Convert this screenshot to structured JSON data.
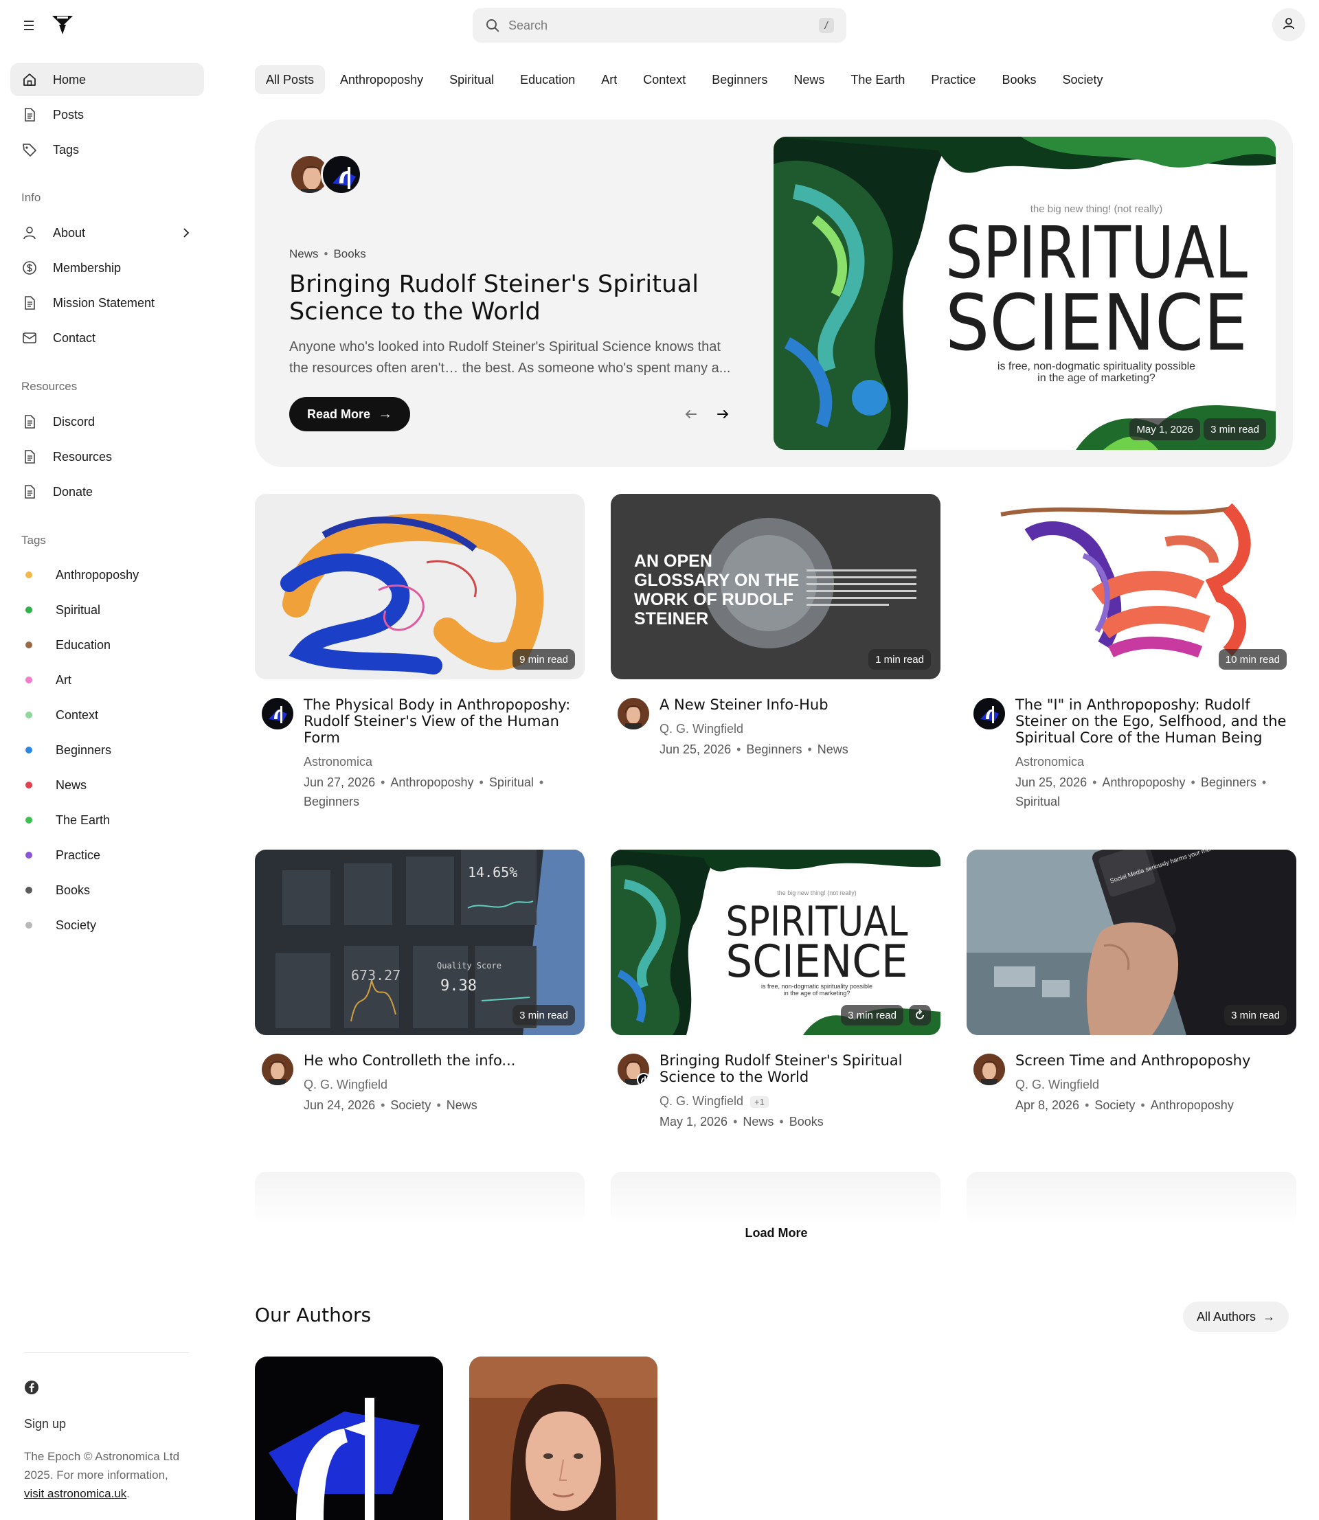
{
  "search": {
    "placeholder": "Search",
    "shortcut": "/"
  },
  "sidebar": {
    "main": [
      {
        "label": "Home",
        "icon": "home-icon"
      },
      {
        "label": "Posts",
        "icon": "document-icon"
      },
      {
        "label": "Tags",
        "icon": "tag-icon"
      }
    ],
    "info_label": "Info",
    "info": [
      {
        "label": "About",
        "icon": "person-icon"
      },
      {
        "label": "Membership",
        "icon": "dollar-icon"
      },
      {
        "label": "Mission Statement",
        "icon": "document-icon"
      },
      {
        "label": "Contact",
        "icon": "mail-icon"
      }
    ],
    "resources_label": "Resources",
    "resources": [
      {
        "label": "Discord",
        "icon": "document-icon"
      },
      {
        "label": "Resources",
        "icon": "document-icon"
      },
      {
        "label": "Donate",
        "icon": "document-icon"
      }
    ],
    "tags_label": "Tags",
    "tags": [
      {
        "label": "Anthropoposhy",
        "color": "#f2b84b"
      },
      {
        "label": "Spiritual",
        "color": "#2fb24c"
      },
      {
        "label": "Education",
        "color": "#9a6a45"
      },
      {
        "label": "Art",
        "color": "#f07ccb"
      },
      {
        "label": "Context",
        "color": "#8fd69a"
      },
      {
        "label": "Beginners",
        "color": "#2d86e0"
      },
      {
        "label": "News",
        "color": "#e2404f"
      },
      {
        "label": "The Earth",
        "color": "#3cc04e"
      },
      {
        "label": "Practice",
        "color": "#8a55d6"
      },
      {
        "label": "Books",
        "color": "#5a5a5a"
      },
      {
        "label": "Society",
        "color": "#b8b8b8"
      }
    ],
    "footer": {
      "signup": "Sign up",
      "copyright": "The Epoch © Astronomica Ltd 2025. For more information,",
      "visit_link": "visit astronomica.uk",
      "period": "."
    }
  },
  "tabs": [
    "All Posts",
    "Anthropoposhy",
    "Spiritual",
    "Education",
    "Art",
    "Context",
    "Beginners",
    "News",
    "The Earth",
    "Practice",
    "Books",
    "Society"
  ],
  "hero": {
    "meta_a": "News",
    "meta_b": "Books",
    "title": "Bringing Rudolf Steiner's Spiritual Science to the World",
    "excerpt": "Anyone who's looked into Rudolf Steiner's Spiritual Science knows that the resources often aren't… the best. As someone who's spent many a...",
    "read_more": "Read More",
    "date": "May 1, 2026",
    "read_time": "3 min read",
    "image_text": {
      "tagline": "the big new thing! (not really)",
      "line1": "SPIRITUAL",
      "line2": "SCIENCE",
      "sub1": "is free, non-dogmatic spirituality possible",
      "sub2": "in the age of marketing?"
    }
  },
  "posts": [
    {
      "title": "The Physical Body in Anthropoposhy: Rudolf Steiner's View of the Human Form",
      "author": "Astronomica",
      "date": "Jun 27, 2026",
      "tags": [
        "Anthropoposhy",
        "Spiritual",
        "Beginners"
      ],
      "read_time": "9 min read"
    },
    {
      "title": "A New Steiner Info-Hub",
      "author": "Q. G. Wingfield",
      "date": "Jun 25, 2026",
      "tags": [
        "Beginners",
        "News"
      ],
      "read_time": "1 min read",
      "image_text": "AN OPEN GLOSSARY ON THE WORK OF RUDOLF STEINER"
    },
    {
      "title": "The \"I\" in Anthropoposhy: Rudolf Steiner on the Ego, Selfhood, and the Spiritual Core of the Human Being",
      "author": "Astronomica",
      "date": "Jun 25, 2026",
      "tags": [
        "Anthropoposhy",
        "Beginners",
        "Spiritual"
      ],
      "read_time": "10 min read"
    },
    {
      "title": "He who Controlleth the info...",
      "author": "Q. G. Wingfield",
      "date": "Jun 24, 2026",
      "tags": [
        "Society",
        "News"
      ],
      "read_time": "3 min read",
      "image_text": {
        "a": "14.65%",
        "b": "Quality Score",
        "c": "9.38",
        "d": "673.27"
      }
    },
    {
      "title": "Bringing Rudolf Steiner's Spiritual Science to the World",
      "author": "Q. G. Wingfield",
      "extra_authors": "+1",
      "date": "May 1, 2026",
      "tags": [
        "News",
        "Books"
      ],
      "read_time": "3 min read"
    },
    {
      "title": "Screen Time and Anthropoposhy",
      "author": "Q. G. Wingfield",
      "date": "Apr 8, 2026",
      "tags": [
        "Society",
        "Anthropoposhy"
      ],
      "read_time": "3 min read",
      "image_text": "Social Media seriously harms your mental health"
    }
  ],
  "load_more": "Load More",
  "authors": {
    "title": "Our Authors",
    "all_label": "All Authors"
  }
}
